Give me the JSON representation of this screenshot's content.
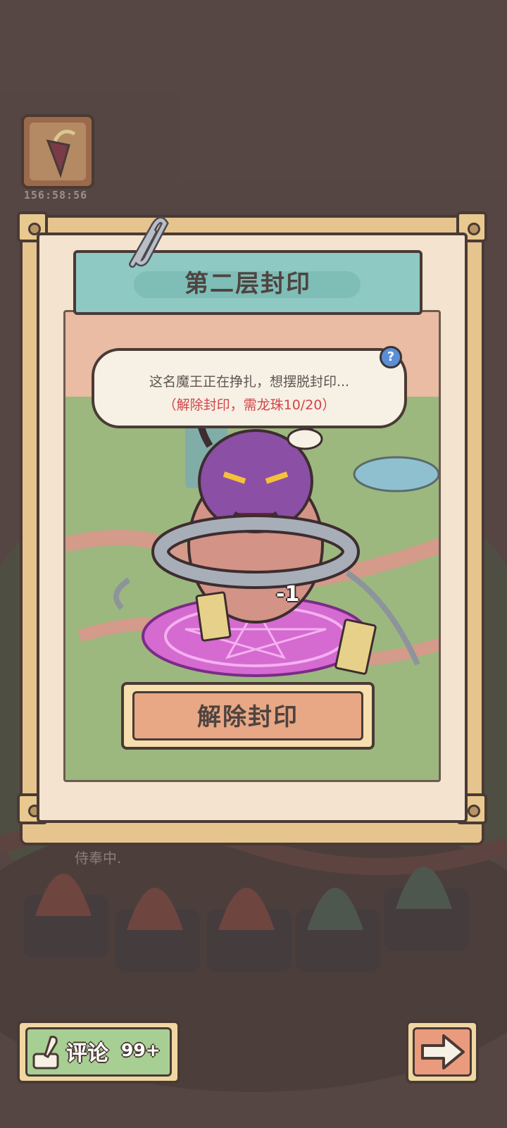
{
  "timer": {
    "text": "156:58:56"
  },
  "dialog": {
    "title": "第二层封印",
    "message": "这名魔王正在挣扎，想摆脱封印...",
    "requirement": "（解除封印，需龙珠10/20）",
    "help_symbol": "?",
    "hit_indicator": "-1",
    "unseal_label": "解除封印"
  },
  "background": {
    "serving_text": "侍奉中."
  },
  "bottom_bar": {
    "comment_label": "评论",
    "comment_count": "99+"
  },
  "colors": {
    "frame": "#e6c48e",
    "title_banner": "#8fc9c3",
    "unseal_button": "#e8a785",
    "comment_button": "#a8cf93",
    "next_button": "#ea9b7e",
    "requirement_text": "#d0444a"
  },
  "icons": {
    "help": "question-mark-icon",
    "comment": "quill-ink-icon",
    "next": "right-arrow-icon",
    "timer_card": "item-card-icon"
  }
}
